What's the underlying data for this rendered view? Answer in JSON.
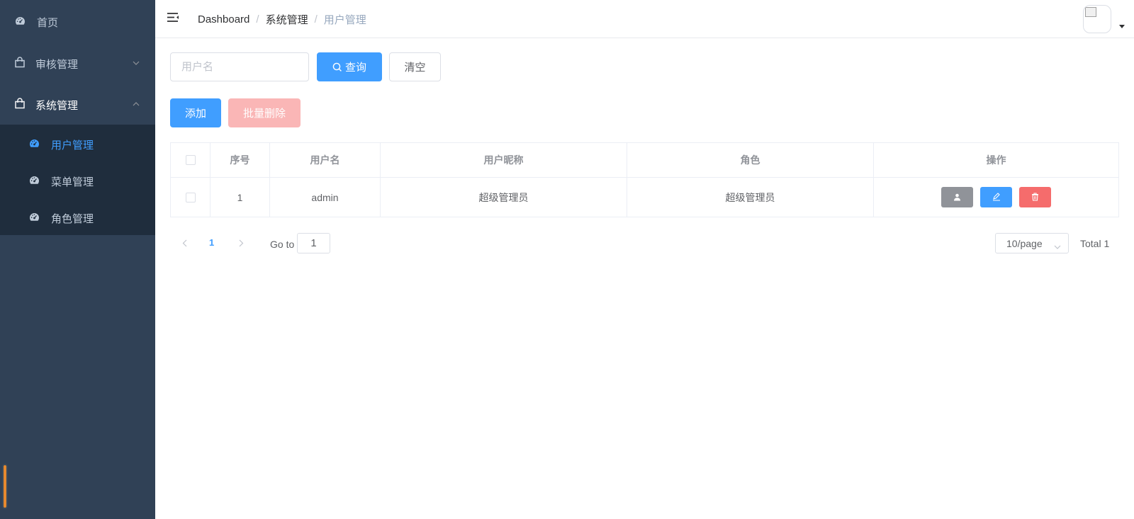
{
  "sidebar": {
    "items": [
      {
        "label": "首页"
      },
      {
        "label": "审核管理"
      },
      {
        "label": "系统管理"
      }
    ],
    "submenu": [
      {
        "label": "用户管理",
        "active": true
      },
      {
        "label": "菜单管理"
      },
      {
        "label": "角色管理"
      }
    ]
  },
  "header": {
    "breadcrumb": [
      "Dashboard",
      "系统管理",
      "用户管理"
    ]
  },
  "filter": {
    "username_placeholder": "用户名",
    "username_value": "",
    "search_label": "查询",
    "clear_label": "清空"
  },
  "toolbar": {
    "add_label": "添加",
    "batch_delete_label": "批量删除"
  },
  "table": {
    "columns": [
      "序号",
      "用户名",
      "用户昵称",
      "角色",
      "操作"
    ],
    "rows": [
      {
        "index": "1",
        "username": "admin",
        "nickname": "超级管理员",
        "role": "超级管理员"
      }
    ]
  },
  "pagination": {
    "current_page": "1",
    "goto_label": "Go to",
    "goto_value": "1",
    "page_size": "10/page",
    "total": "Total 1"
  },
  "colors": {
    "sidebar_bg": "#304156",
    "submenu_bg": "#1f2d3d",
    "primary": "#409eff",
    "danger": "#f56c6c",
    "info": "#909399"
  }
}
